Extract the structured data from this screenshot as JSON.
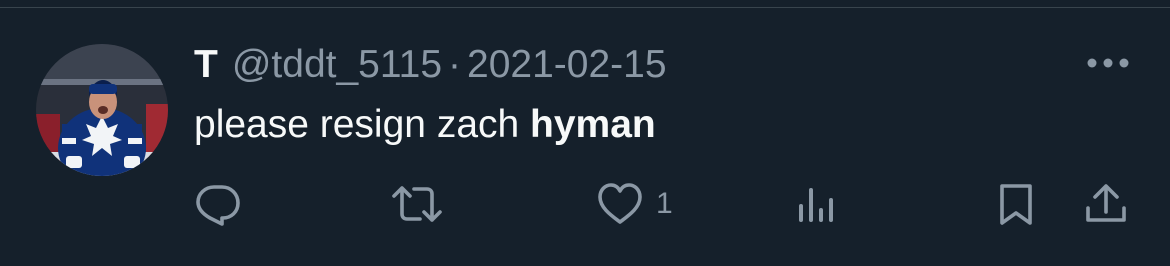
{
  "tweet": {
    "author": {
      "display_name": "T",
      "handle": "@tddt_5115",
      "avatar_icon": "hockey-player-avatar"
    },
    "separator": "·",
    "date": "2021-02-15",
    "text_plain": "please resign zach ",
    "text_bold": "hyman",
    "more_icon": "more-dots-icon"
  },
  "actions": {
    "reply": {
      "icon": "reply-icon"
    },
    "retweet": {
      "icon": "retweet-icon"
    },
    "like": {
      "icon": "heart-icon",
      "count": "1"
    },
    "views": {
      "icon": "views-chart-icon"
    },
    "bookmark": {
      "icon": "bookmark-icon"
    },
    "share": {
      "icon": "share-icon"
    }
  },
  "colors": {
    "background": "#15202b",
    "primary_text": "#f7f9f9",
    "secondary_text": "#8b98a5",
    "divider": "#38444d"
  }
}
